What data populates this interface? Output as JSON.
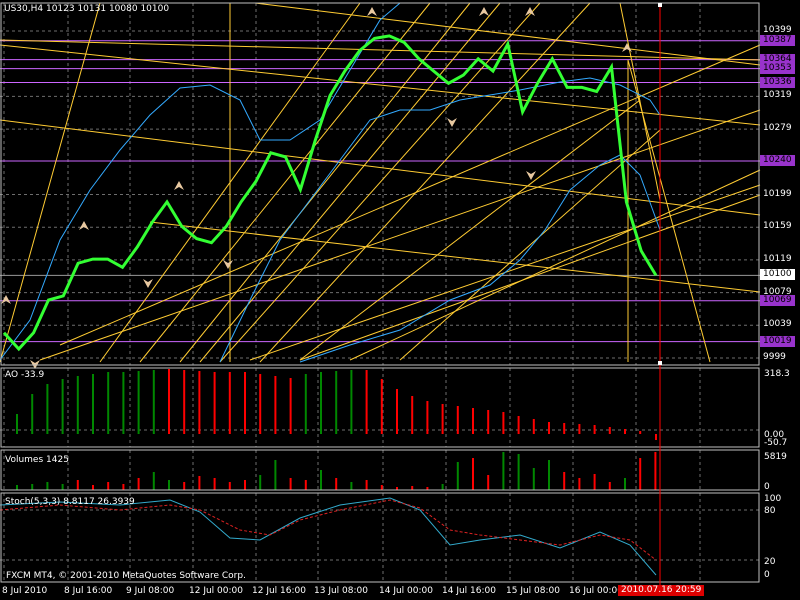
{
  "main": {
    "symbol_info": "US30,H4  10123 10131 10080 10100",
    "price_levels": [
      {
        "value": 10399,
        "label": "10399",
        "boxed": false
      },
      {
        "value": 10387,
        "label": "10387",
        "boxed": true,
        "color": "#9933cc"
      },
      {
        "value": 10364,
        "label": "10364",
        "boxed": true,
        "color": "#9933cc"
      },
      {
        "value": 10353,
        "label": "10353",
        "boxed": true,
        "color": "#9933cc"
      },
      {
        "value": 10336,
        "label": "10336",
        "boxed": true,
        "color": "#9933cc"
      },
      {
        "value": 10319,
        "label": "10319",
        "boxed": false
      },
      {
        "value": 10279,
        "label": "10279",
        "boxed": false
      },
      {
        "value": 10240,
        "label": "10240",
        "boxed": true,
        "color": "#9933cc"
      },
      {
        "value": 10199,
        "label": "10199",
        "boxed": false
      },
      {
        "value": 10159,
        "label": "10159",
        "boxed": false
      },
      {
        "value": 10119,
        "label": "10119",
        "boxed": false
      },
      {
        "value": 10100,
        "label": "10100",
        "boxed": true,
        "color": "#ffffff",
        "current": true
      },
      {
        "value": 10079,
        "label": "10079",
        "boxed": false
      },
      {
        "value": 10069,
        "label": "10069",
        "boxed": true,
        "color": "#9933cc"
      },
      {
        "value": 10039,
        "label": "10039",
        "boxed": false
      },
      {
        "value": 10019,
        "label": "10019",
        "boxed": true,
        "color": "#9933cc"
      },
      {
        "value": 9999,
        "label": "9999",
        "boxed": false
      }
    ]
  },
  "ao": {
    "title": "AO -33.9",
    "scale_top": "318.3",
    "scale_zero": "0.00",
    "scale_bottom": "-50.7"
  },
  "volumes": {
    "title": "Volumes 1425",
    "scale_top": "5819",
    "scale_zero": "0"
  },
  "stoch": {
    "title": "Stoch(5,3,3) 8.8117 26.3939",
    "levels": [
      "100",
      "80",
      "20",
      "0"
    ]
  },
  "copyright": "FXCM MT4, © 2001-2010 MetaQuotes Software Corp.",
  "time_axis": {
    "labels": [
      "8 Jul 2010",
      "8 Jul 16:00",
      "9 Jul 08:00",
      "12 Jul 00:00",
      "12 Jul 16:00",
      "13 Jul 08:00",
      "14 Jul 00:00",
      "14 Jul 16:00",
      "15 Jul 08:00",
      "16 Jul 00:00",
      "16 Jul 16:00"
    ],
    "current_time": "2010.07.16 20:59"
  },
  "colors": {
    "price": "#33ff33",
    "ma": "#33aaff",
    "grid": "#6e6e6e",
    "trend": "#ffcc33",
    "level": "#cc66ff",
    "ao_up": "#008800",
    "ao_down": "#ff0000",
    "stoch_main": "#33aacc",
    "stoch_signal": "#dd2222",
    "cursor": "#ff0000"
  },
  "chart_data": {
    "type": "line",
    "series": [
      {
        "values": [
          10030,
          10010,
          10030,
          10070,
          10075,
          10115,
          10120,
          10120,
          10110,
          10135,
          10165,
          10190,
          10160,
          10145,
          10140,
          10160,
          10190,
          10215,
          10250,
          10245,
          10205,
          10265,
          10320,
          10350,
          10375,
          10390,
          10393,
          10385,
          10365,
          10350,
          10335,
          10345,
          10365,
          10350,
          10383,
          10300,
          10335,
          10365,
          10330,
          10330,
          10325,
          10355,
          10190,
          10130,
          10100
        ]
      }
    ]
  }
}
